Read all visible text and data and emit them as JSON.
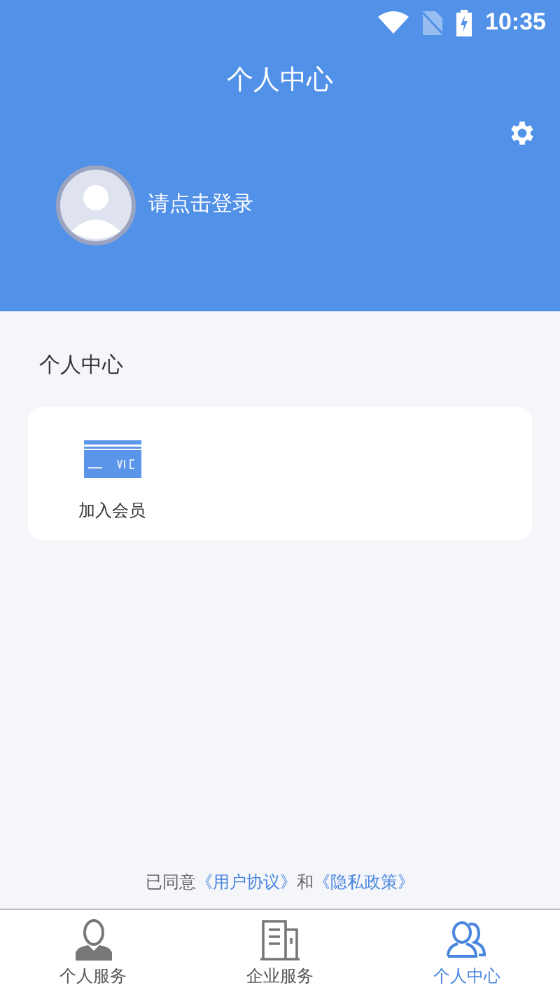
{
  "status_bar": {
    "time": "10:35"
  },
  "header": {
    "title": "个人中心",
    "login_prompt": "请点击登录"
  },
  "section": {
    "title": "个人中心",
    "items": [
      {
        "label": "加入会员",
        "kind": "card"
      }
    ]
  },
  "agreement": {
    "prefix": "已同意",
    "link_1": "《用户协议》",
    "joiner": "和",
    "link_2": "《隐私政策》"
  },
  "tabs": [
    {
      "label": "个人服务",
      "kind": "person",
      "selected": false
    },
    {
      "label": "企业服务",
      "kind": "building",
      "selected": false
    },
    {
      "label": "个人中心",
      "kind": "people",
      "selected": true
    }
  ]
}
